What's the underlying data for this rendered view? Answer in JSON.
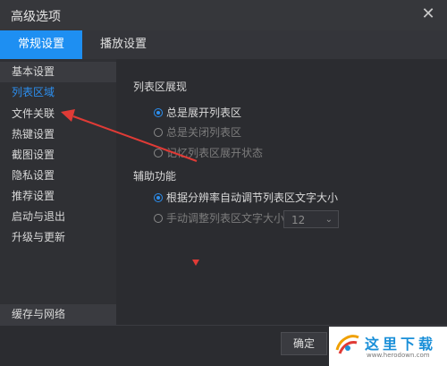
{
  "window": {
    "title": "高级选项",
    "close_icon": "close-icon"
  },
  "tabs": [
    {
      "label": "常规设置",
      "active": true
    },
    {
      "label": "播放设置",
      "active": false
    }
  ],
  "sidebar": {
    "items": [
      {
        "label": "基本设置"
      },
      {
        "label": "列表区域",
        "active": true
      },
      {
        "label": "文件关联"
      },
      {
        "label": "热键设置"
      },
      {
        "label": "截图设置"
      },
      {
        "label": "隐私设置"
      },
      {
        "label": "推荐设置"
      },
      {
        "label": "启动与退出"
      },
      {
        "label": "升级与更新"
      }
    ],
    "bottom_label": "缓存与网络"
  },
  "content": {
    "list_section": {
      "title": "列表区展现",
      "options": [
        {
          "label": "总是展开列表区",
          "checked": true,
          "disabled": false
        },
        {
          "label": "总是关闭列表区",
          "checked": false,
          "disabled": true
        },
        {
          "label": "记忆列表区展开状态",
          "checked": false,
          "disabled": true
        }
      ]
    },
    "assist_section": {
      "title": "辅助功能",
      "options": [
        {
          "label": "根据分辨率自动调节列表区文字大小",
          "checked": true,
          "disabled": false
        },
        {
          "label": "手动调整列表区文字大小",
          "checked": false,
          "disabled": true
        }
      ],
      "font_size_value": "12"
    }
  },
  "footer": {
    "ok_label": "确定"
  },
  "watermark": {
    "text": "这里下载",
    "url": "www.herodown.com"
  },
  "colors": {
    "accent": "#1e8ff2",
    "annotation": "#e03b36"
  }
}
